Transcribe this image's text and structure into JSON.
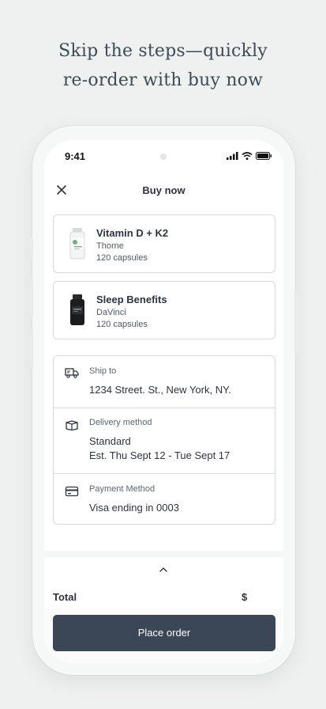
{
  "headline": {
    "line1": "Skip the steps—quickly",
    "line2": "re-order with buy now"
  },
  "status_bar": {
    "time": "9:41",
    "icons": [
      "signal-icon",
      "wifi-icon",
      "battery-icon"
    ]
  },
  "nav": {
    "title": "Buy now",
    "close_icon": "close-icon"
  },
  "products": [
    {
      "name": "Vitamin D + K2",
      "brand": "Thorne",
      "quantity": "120 capsules",
      "image": "white-bottle"
    },
    {
      "name": "Sleep Benefits",
      "brand": "DaVinci",
      "quantity": "120 capsules",
      "image": "black-bottle"
    }
  ],
  "order_details": {
    "ship_to": {
      "label": "Ship to",
      "value": "1234 Street. St., New York, NY.",
      "icon": "truck-icon"
    },
    "delivery": {
      "label": "Delivery method",
      "method": "Standard",
      "estimate": "Est. Thu Sept 12 - Tue Sept 17",
      "icon": "box-icon"
    },
    "payment": {
      "label": "Payment Method",
      "value": "Visa ending in 0003",
      "icon": "credit-card-icon"
    }
  },
  "summary": {
    "total_label": "Total",
    "total_value": "$",
    "expand_icon": "chevron-up-icon"
  },
  "actions": {
    "place_order": "Place order"
  },
  "colors": {
    "background": "#eef1ef",
    "button": "#3b4656",
    "border": "#d6dadb",
    "text": "#2b3440"
  }
}
